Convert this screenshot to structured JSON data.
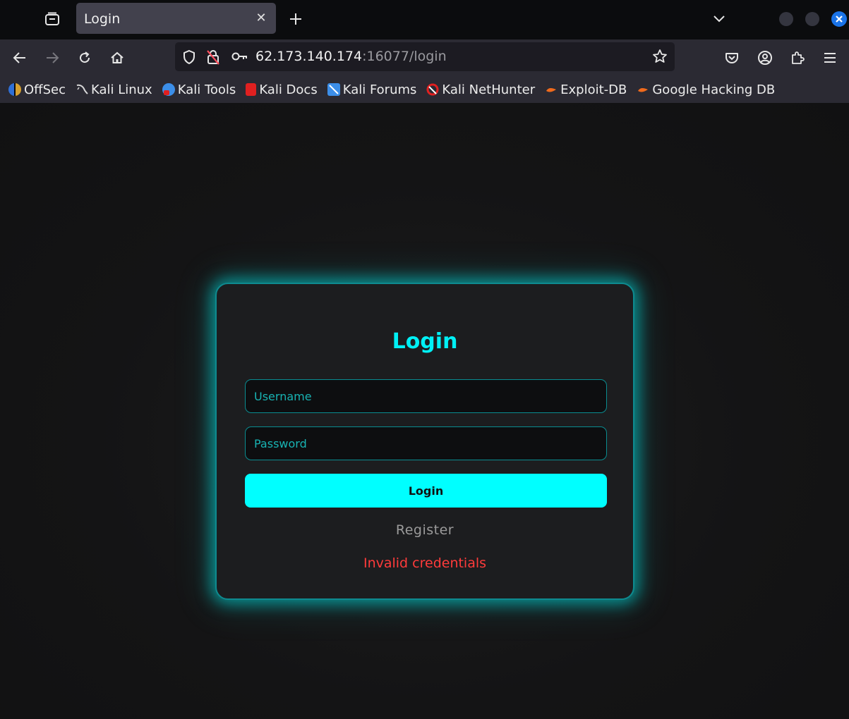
{
  "browser": {
    "tab": {
      "title": "Login"
    },
    "url": {
      "host": "62.173.140.174",
      "rest": ":16077/login"
    },
    "bookmarks": [
      {
        "label": "OffSec",
        "icon": "offsec-icon",
        "color": "#3a7bd5"
      },
      {
        "label": "Kali Linux",
        "icon": "kali-dragon-icon",
        "color": "#d0d0d0"
      },
      {
        "label": "Kali Tools",
        "icon": "kali-tools-icon",
        "color": "#3c8ee8"
      },
      {
        "label": "Kali Docs",
        "icon": "kali-docs-icon",
        "color": "#e02020"
      },
      {
        "label": "Kali Forums",
        "icon": "kali-forums-icon",
        "color": "#3c8ee8"
      },
      {
        "label": "Kali NetHunter",
        "icon": "nethunter-icon",
        "color": "#e02020"
      },
      {
        "label": "Exploit-DB",
        "icon": "exploit-db-icon",
        "color": "#f06a1c"
      },
      {
        "label": "Google Hacking DB",
        "icon": "ghdb-icon",
        "color": "#f06a1c"
      }
    ]
  },
  "login": {
    "title": "Login",
    "username_placeholder": "Username",
    "password_placeholder": "Password",
    "button_label": "Login",
    "register_label": "Register",
    "error": "Invalid credentials"
  },
  "colors": {
    "accent": "#00ffff",
    "error": "#ff3b3b"
  }
}
